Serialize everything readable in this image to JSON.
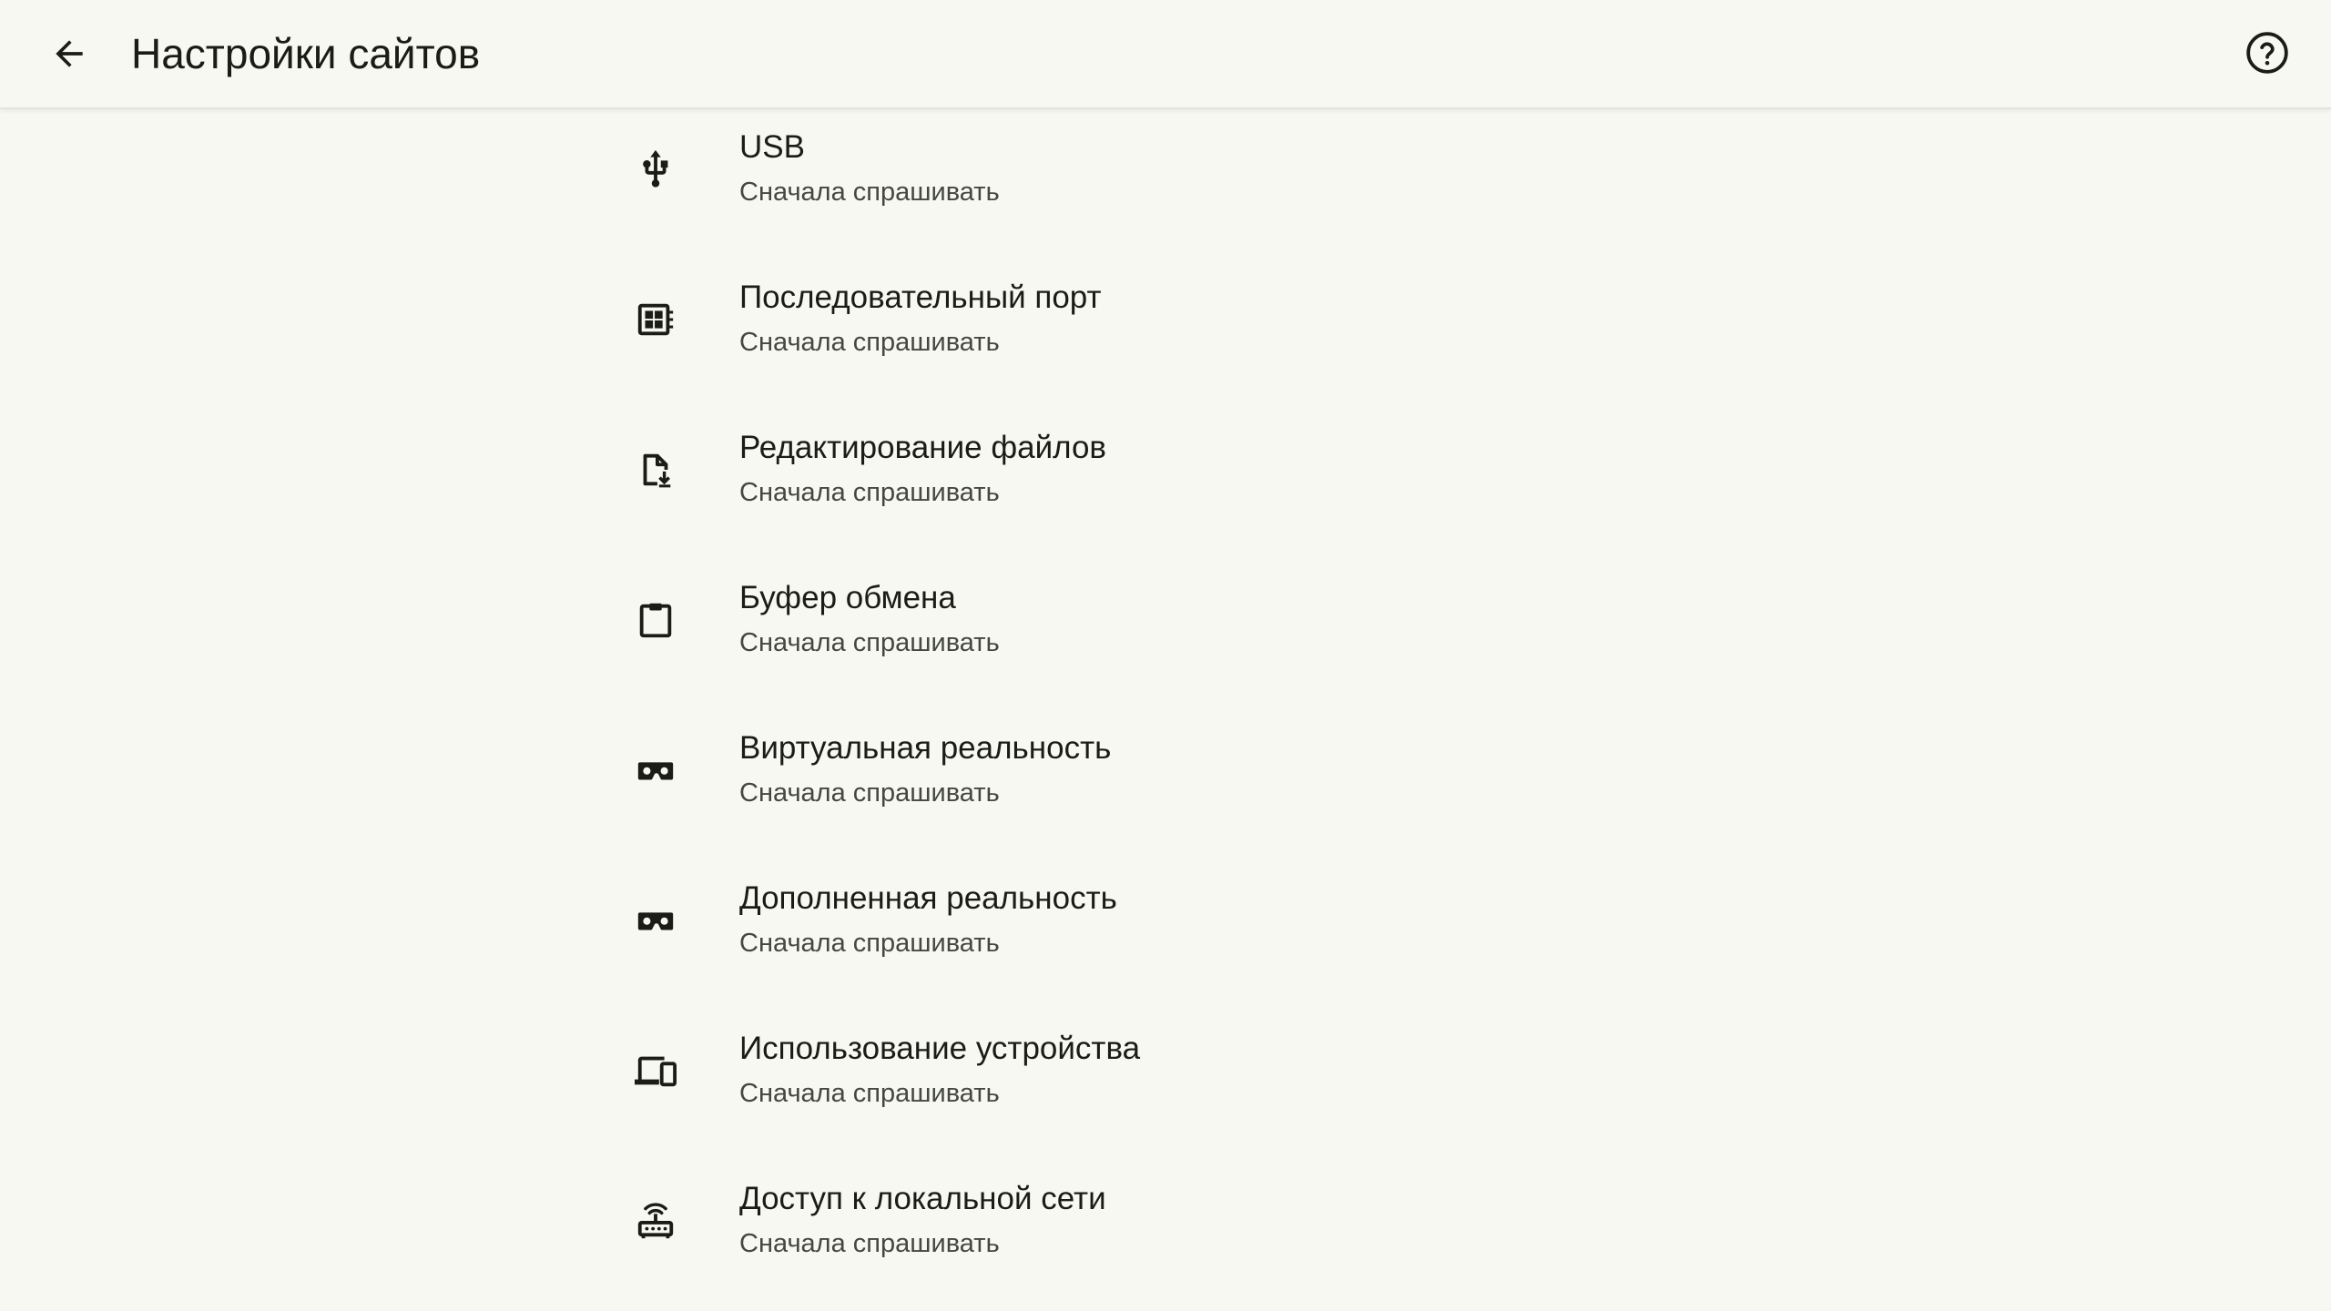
{
  "header": {
    "title": "Настройки сайтов",
    "back_icon": "arrow-back-icon",
    "help_icon": "help-circle-icon"
  },
  "colors": {
    "background": "#f7f8f2",
    "text_primary": "#1b1c18",
    "text_secondary": "#45483f"
  },
  "settings": {
    "items": [
      {
        "icon": "usb-icon",
        "title": "USB",
        "subtitle": "Сначала спрашивать"
      },
      {
        "icon": "serial-port-icon",
        "title": "Последовательный порт",
        "subtitle": "Сначала спрашивать"
      },
      {
        "icon": "file-edit-icon",
        "title": "Редактирование файлов",
        "subtitle": "Сначала спрашивать"
      },
      {
        "icon": "clipboard-icon",
        "title": "Буфер обмена",
        "subtitle": "Сначала спрашивать"
      },
      {
        "icon": "vr-headset-icon",
        "title": "Виртуальная реальность",
        "subtitle": "Сначала спрашивать"
      },
      {
        "icon": "ar-headset-icon",
        "title": "Дополненная реальность",
        "subtitle": "Сначала спрашивать"
      },
      {
        "icon": "devices-icon",
        "title": "Использование устройства",
        "subtitle": "Сначала спрашивать"
      },
      {
        "icon": "router-icon",
        "title": "Доступ к локальной сети",
        "subtitle": "Сначала спрашивать"
      }
    ]
  }
}
